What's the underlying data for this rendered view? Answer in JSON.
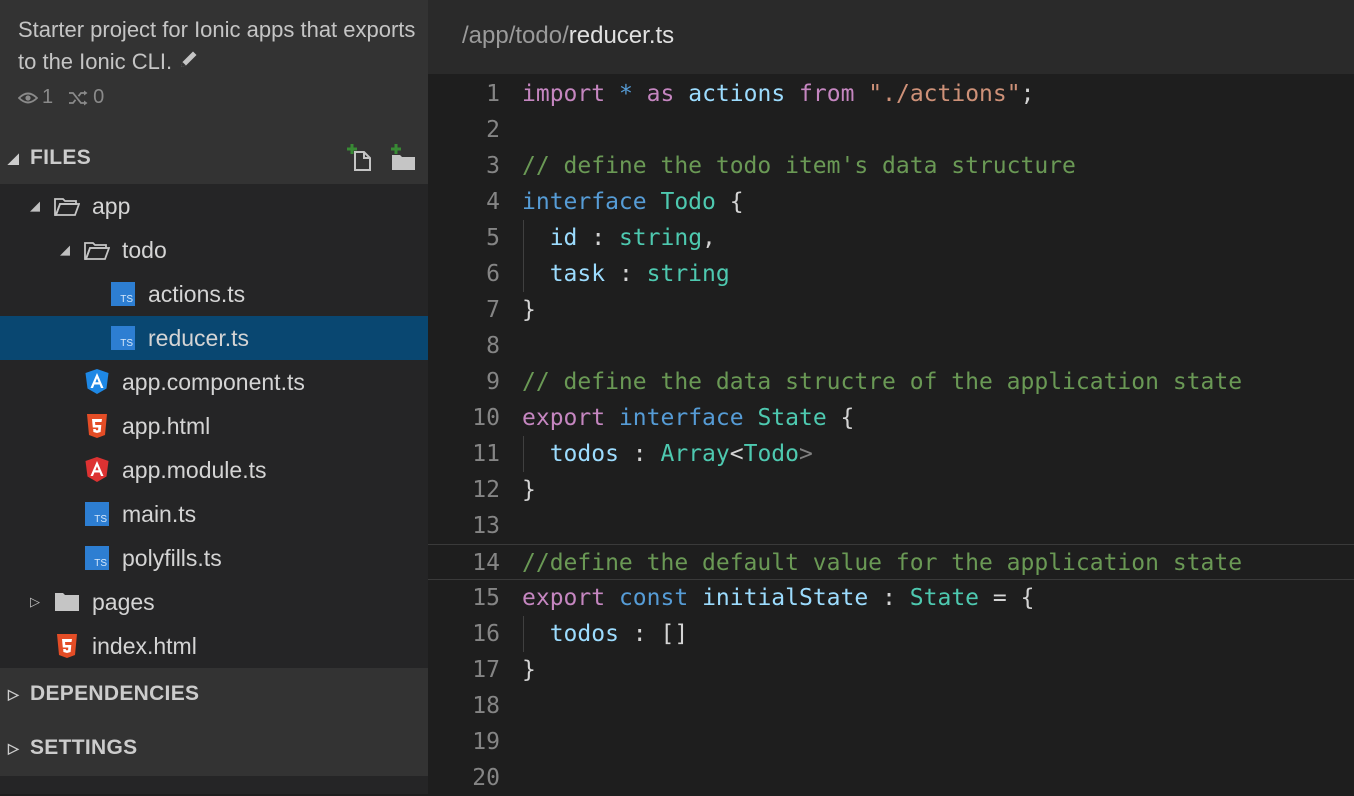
{
  "project": {
    "description": "Starter project for Ionic apps that exports to the Ionic CLI.",
    "watchers": "1",
    "forks": "0"
  },
  "sections": {
    "files": "FILES",
    "dependencies": "DEPENDENCIES",
    "settings": "SETTINGS"
  },
  "tree": [
    {
      "label": "app",
      "type": "folder-open",
      "depth": 1
    },
    {
      "label": "todo",
      "type": "folder-open",
      "depth": 2
    },
    {
      "label": "actions.ts",
      "type": "ts",
      "depth": 3
    },
    {
      "label": "reducer.ts",
      "type": "ts",
      "depth": 3,
      "selected": true
    },
    {
      "label": "app.component.ts",
      "type": "angular-blue",
      "depth": 2
    },
    {
      "label": "app.html",
      "type": "html5",
      "depth": 2
    },
    {
      "label": "app.module.ts",
      "type": "angular-red",
      "depth": 2
    },
    {
      "label": "main.ts",
      "type": "ts",
      "depth": 2
    },
    {
      "label": "polyfills.ts",
      "type": "ts",
      "depth": 2
    },
    {
      "label": "pages",
      "type": "folder-closed",
      "depth": 1
    },
    {
      "label": "index.html",
      "type": "html5",
      "depth": 1
    }
  ],
  "breadcrumb": {
    "path": "/app/todo/",
    "file": "reducer.ts"
  },
  "code_lines": [
    {
      "n": "1",
      "tokens": [
        [
          "k",
          "import"
        ],
        [
          "p",
          " "
        ],
        [
          "kw",
          "*"
        ],
        [
          "p",
          " "
        ],
        [
          "k",
          "as"
        ],
        [
          "p",
          " "
        ],
        [
          "v",
          "actions"
        ],
        [
          "p",
          " "
        ],
        [
          "k",
          "from"
        ],
        [
          "p",
          " "
        ],
        [
          "s",
          "\"./actions\""
        ],
        [
          "p",
          ";"
        ]
      ]
    },
    {
      "n": "2",
      "tokens": []
    },
    {
      "n": "3",
      "tokens": [
        [
          "c",
          "// define the todo item's data structure"
        ]
      ]
    },
    {
      "n": "4",
      "tokens": [
        [
          "kw",
          "interface"
        ],
        [
          "p",
          " "
        ],
        [
          "t",
          "Todo"
        ],
        [
          "p",
          " {"
        ]
      ]
    },
    {
      "n": "5",
      "tokens": [
        [
          "p",
          "  "
        ],
        [
          "v",
          "id"
        ],
        [
          "p",
          " : "
        ],
        [
          "t",
          "string"
        ],
        [
          "p",
          ","
        ]
      ],
      "guide": true
    },
    {
      "n": "6",
      "tokens": [
        [
          "p",
          "  "
        ],
        [
          "v",
          "task"
        ],
        [
          "p",
          " : "
        ],
        [
          "t",
          "string"
        ]
      ],
      "guide": true
    },
    {
      "n": "7",
      "tokens": [
        [
          "p",
          "}"
        ]
      ]
    },
    {
      "n": "8",
      "tokens": []
    },
    {
      "n": "9",
      "tokens": [
        [
          "c",
          "// define the data structre of the application state"
        ]
      ]
    },
    {
      "n": "10",
      "tokens": [
        [
          "k",
          "export"
        ],
        [
          "p",
          " "
        ],
        [
          "kw",
          "interface"
        ],
        [
          "p",
          " "
        ],
        [
          "t",
          "State"
        ],
        [
          "p",
          " {"
        ]
      ]
    },
    {
      "n": "11",
      "tokens": [
        [
          "p",
          "  "
        ],
        [
          "v",
          "todos"
        ],
        [
          "p",
          " : "
        ],
        [
          "t",
          "Array"
        ],
        [
          "p",
          "<"
        ],
        [
          "t",
          "Todo"
        ],
        [
          "g",
          ">"
        ]
      ],
      "guide": true
    },
    {
      "n": "12",
      "tokens": [
        [
          "p",
          "}"
        ]
      ]
    },
    {
      "n": "13",
      "tokens": []
    },
    {
      "n": "14",
      "tokens": [
        [
          "c",
          "//define the default value for the application state"
        ]
      ],
      "active": true
    },
    {
      "n": "15",
      "tokens": [
        [
          "k",
          "export"
        ],
        [
          "p",
          " "
        ],
        [
          "kw",
          "const"
        ],
        [
          "p",
          " "
        ],
        [
          "v",
          "initialState"
        ],
        [
          "p",
          " : "
        ],
        [
          "t",
          "State"
        ],
        [
          "p",
          " = {"
        ]
      ]
    },
    {
      "n": "16",
      "tokens": [
        [
          "p",
          "  "
        ],
        [
          "v",
          "todos"
        ],
        [
          "p",
          " : []"
        ]
      ],
      "guide": true
    },
    {
      "n": "17",
      "tokens": [
        [
          "p",
          "}"
        ]
      ]
    },
    {
      "n": "18",
      "tokens": []
    },
    {
      "n": "19",
      "tokens": []
    },
    {
      "n": "20",
      "tokens": []
    }
  ]
}
